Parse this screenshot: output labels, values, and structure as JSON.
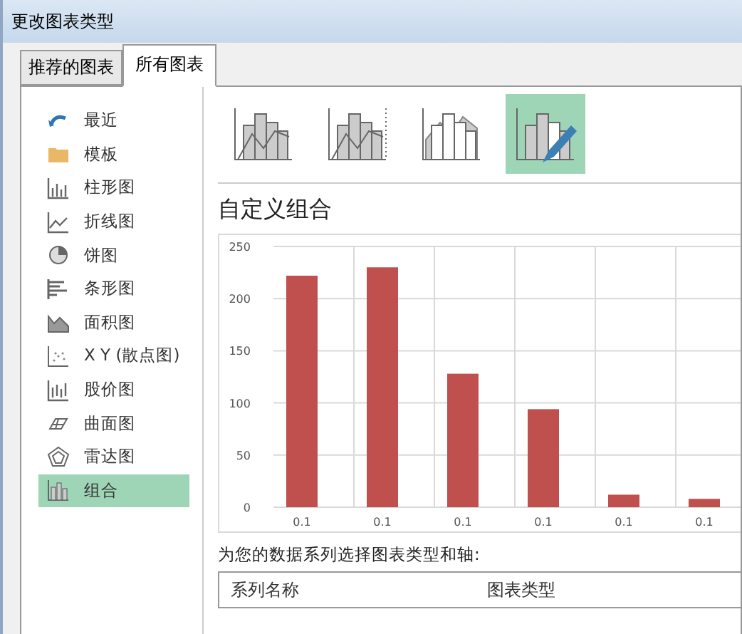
{
  "window": {
    "title": "更改图表类型"
  },
  "tabs": [
    {
      "label": "推荐的图表",
      "selected": false
    },
    {
      "label": "所有图表",
      "selected": true
    }
  ],
  "sidebar": {
    "items": [
      {
        "label": "最近",
        "selected": false
      },
      {
        "label": "模板",
        "selected": false
      },
      {
        "label": "柱形图",
        "selected": false
      },
      {
        "label": "折线图",
        "selected": false
      },
      {
        "label": "饼图",
        "selected": false
      },
      {
        "label": "条形图",
        "selected": false
      },
      {
        "label": "面积图",
        "selected": false
      },
      {
        "label": "X Y (散点图)",
        "selected": false
      },
      {
        "label": "股价图",
        "selected": false
      },
      {
        "label": "曲面图",
        "selected": false
      },
      {
        "label": "雷达图",
        "selected": false
      },
      {
        "label": "组合",
        "selected": true
      }
    ]
  },
  "subtypes": [
    {
      "selected": false
    },
    {
      "selected": false
    },
    {
      "selected": false
    },
    {
      "selected": true
    }
  ],
  "preview": {
    "title": "自定义组合",
    "chart_data": {
      "type": "bar",
      "categories": [
        "0.1",
        "0.1",
        "0.1",
        "0.1",
        "0.1",
        "0.1"
      ],
      "grid": true,
      "series": [
        {
          "color": "#c0504d",
          "values": [
            222,
            230,
            128,
            94,
            12,
            8
          ]
        }
      ],
      "ylim": [
        0,
        250
      ],
      "yticks": [
        0,
        50,
        100,
        150,
        200,
        250
      ]
    }
  },
  "series_prompt": "为您的数据系列选择图表类型和轴:",
  "table": {
    "columns": [
      "系列名称",
      "图表类型"
    ]
  }
}
